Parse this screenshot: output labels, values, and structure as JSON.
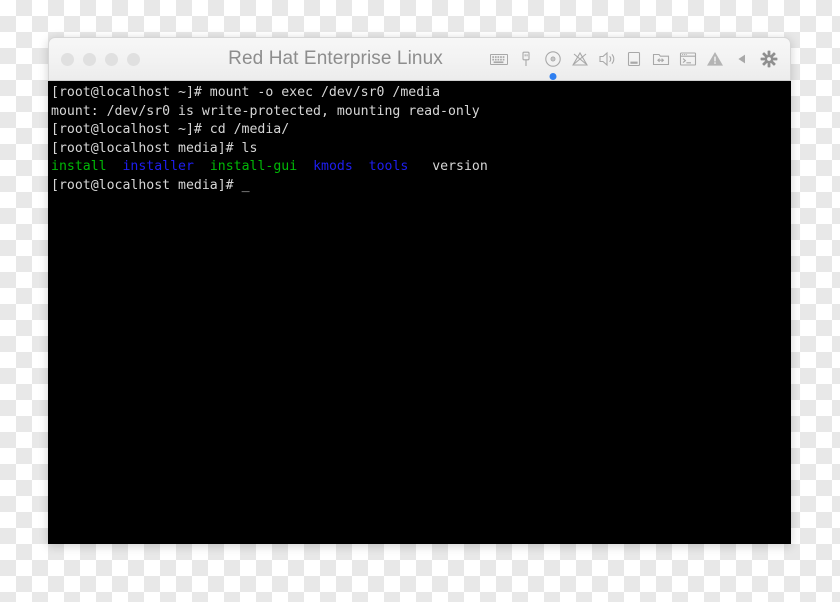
{
  "window": {
    "title": "Red Hat Enterprise Linux",
    "traffic_lights": [
      {
        "name": "close",
        "color": "#e0e0e0"
      },
      {
        "name": "minimize",
        "color": "#e0e0e0"
      },
      {
        "name": "maximize",
        "color": "#e0e0e0"
      },
      {
        "name": "fullscreen",
        "color": "#e0e0e0"
      }
    ],
    "status_icons": [
      {
        "name": "keyboard-icon",
        "label": "Keyboard"
      },
      {
        "name": "usb-icon",
        "label": "USB"
      },
      {
        "name": "optical-disc-icon",
        "label": "CD/DVD",
        "active": true,
        "active_color": "#2f7ff0"
      },
      {
        "name": "network-disconnected-icon",
        "label": "Network"
      },
      {
        "name": "audio-icon",
        "label": "Sound"
      },
      {
        "name": "hard-disk-icon",
        "label": "Hard Disk"
      },
      {
        "name": "shared-folder-icon",
        "label": "Shared Folders"
      },
      {
        "name": "console-icon",
        "label": "Console"
      },
      {
        "name": "warning-icon",
        "label": "Warning"
      },
      {
        "name": "collapse-arrow-icon",
        "label": "Collapse"
      },
      {
        "name": "gear-icon",
        "label": "Settings"
      }
    ]
  },
  "terminal": {
    "background": "#000000",
    "colors": {
      "white": "#d6d6d6",
      "green": "#00b806",
      "blue": "#1e1ef0"
    },
    "cursor": "_",
    "lines": [
      {
        "segments": [
          {
            "text": "[root@localhost ~]# mount -o exec /dev/sr0 /media",
            "color": "white"
          }
        ]
      },
      {
        "segments": [
          {
            "text": "mount: /dev/sr0 is write-protected, mounting read-only",
            "color": "white"
          }
        ]
      },
      {
        "segments": [
          {
            "text": "[root@localhost ~]# cd /media/",
            "color": "white"
          }
        ]
      },
      {
        "segments": [
          {
            "text": "[root@localhost media]# ls",
            "color": "white"
          }
        ]
      },
      {
        "segments": [
          {
            "text": "install",
            "color": "green"
          },
          {
            "text": "  ",
            "color": "white"
          },
          {
            "text": "installer",
            "color": "blue"
          },
          {
            "text": "  ",
            "color": "white"
          },
          {
            "text": "install-gui",
            "color": "green"
          },
          {
            "text": "  ",
            "color": "white"
          },
          {
            "text": "kmods",
            "color": "blue"
          },
          {
            "text": "  ",
            "color": "white"
          },
          {
            "text": "tools",
            "color": "blue"
          },
          {
            "text": "   ",
            "color": "white"
          },
          {
            "text": "version",
            "color": "white"
          }
        ]
      },
      {
        "segments": [
          {
            "text": "[root@localhost media]# ",
            "color": "white"
          },
          {
            "text": "_",
            "color": "white"
          }
        ]
      }
    ]
  }
}
